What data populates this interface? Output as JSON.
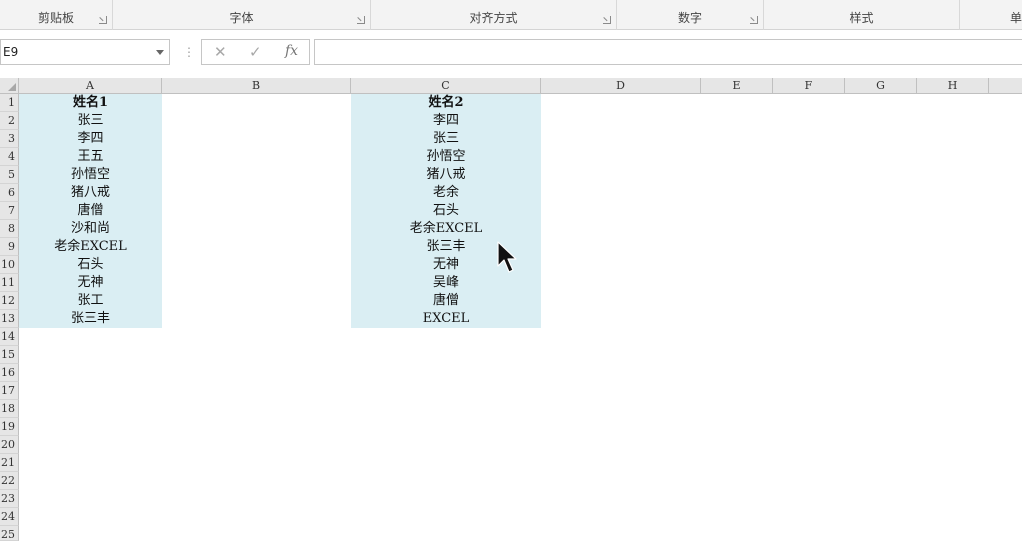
{
  "ribbon": {
    "groups": [
      {
        "label": "剪贴板",
        "launcher": true
      },
      {
        "label": "字体",
        "launcher": true
      },
      {
        "label": "对齐方式",
        "launcher": true
      },
      {
        "label": "数字",
        "launcher": true
      },
      {
        "label": "样式",
        "launcher": false
      },
      {
        "label": "单",
        "launcher": false
      }
    ]
  },
  "formula_bar": {
    "name_box": "E9",
    "cancel_icon": "✕",
    "enter_icon": "✓",
    "fx_icon": "fx",
    "formula": ""
  },
  "columns": [
    "A",
    "B",
    "C",
    "D",
    "E",
    "F",
    "G",
    "H"
  ],
  "rows": [
    "1",
    "2",
    "3",
    "4",
    "5",
    "6",
    "7",
    "8",
    "9",
    "10",
    "11",
    "12",
    "13",
    "14",
    "15",
    "16",
    "17",
    "18",
    "19",
    "20",
    "21",
    "22",
    "23",
    "24",
    "25"
  ],
  "sheet": {
    "col_a": [
      "姓名1",
      "张三",
      "李四",
      "王五",
      "孙悟空",
      "猪八戒",
      "唐僧",
      "沙和尚",
      "老余EXCEL",
      "石头",
      "无神",
      "张工",
      "张三丰"
    ],
    "col_c": [
      "姓名2",
      "李四",
      "张三",
      "孙悟空",
      "猪八戒",
      "老余",
      "石头",
      "老余EXCEL",
      "张三丰",
      "无神",
      "吴峰",
      "唐僧",
      "EXCEL"
    ]
  },
  "colors": {
    "highlight_fill": "#daeef3",
    "header_bg": "#e6e6e6"
  },
  "icons": {
    "select_all": "select-all-triangle-icon",
    "cursor": "mouse-pointer-icon",
    "dropdown": "chevron-down-icon",
    "launcher": "dialog-launcher-icon"
  }
}
